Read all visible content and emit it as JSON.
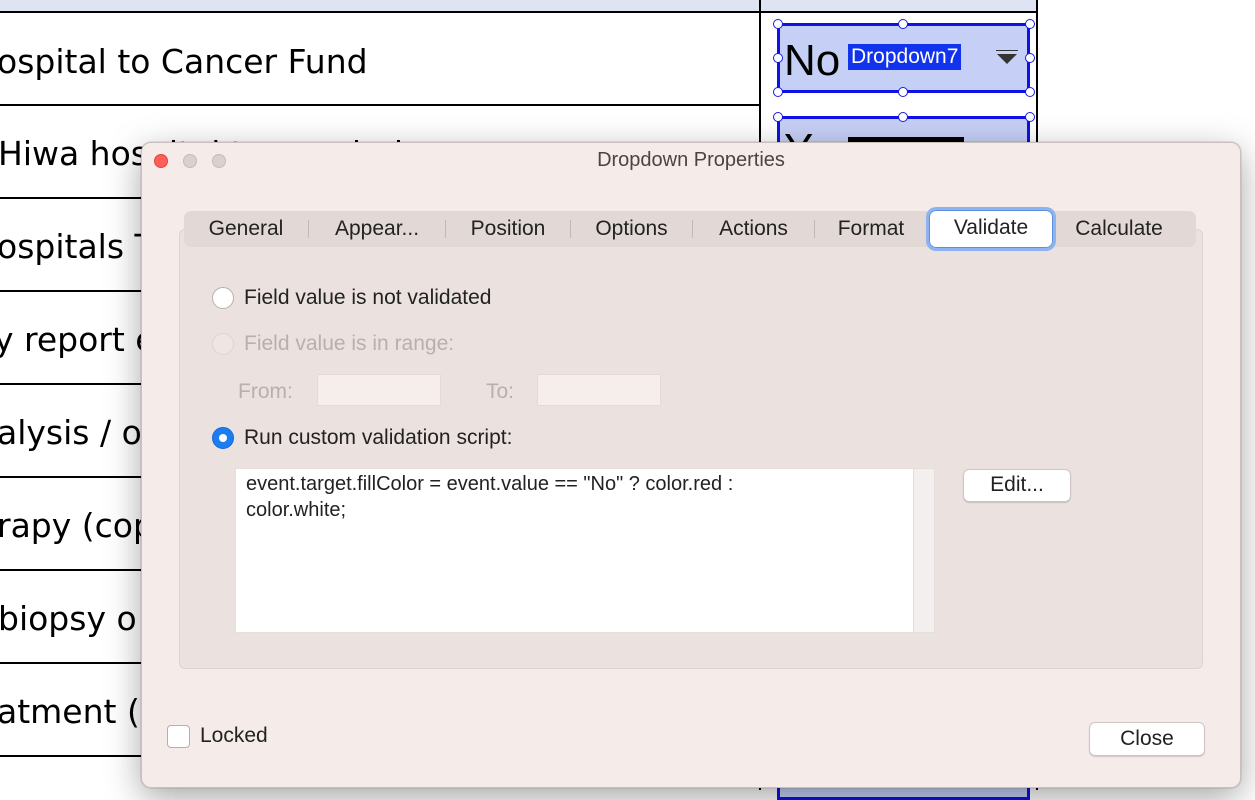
{
  "document": {
    "rows": [
      "ospital to Cancer Fund",
      " Hiwa hospital to conclude",
      "ospitals T",
      "y report e",
      "alysis / o",
      "rapy (cop",
      " biopsy o",
      "atment (i"
    ],
    "field1": {
      "value": "No",
      "name": "Dropdown7"
    },
    "field2": {
      "value": "Y"
    }
  },
  "dialog": {
    "title": "Dropdown Properties",
    "tabs": [
      "General",
      "Appear...",
      "Position",
      "Options",
      "Actions",
      "Format",
      "Validate",
      "Calculate"
    ],
    "selected_tab": "Validate",
    "validate": {
      "option_not_validated": "Field value is not validated",
      "option_in_range": "Field value is in range:",
      "from_label": "From:",
      "to_label": "To:",
      "from_value": "",
      "to_value": "",
      "option_custom_script": "Run custom validation script:",
      "selected_option": "custom_script",
      "script": "event.target.fillColor = event.value == \"No\" ? color.red :\ncolor.white;",
      "edit_label": "Edit..."
    },
    "locked_label": "Locked",
    "locked_checked": false,
    "close_label": "Close"
  },
  "colors": {
    "accent": "#1c7cf4",
    "field_fill": "#c6d0f6",
    "field_border": "#1010e8",
    "dialog_bg": "#f5ebe8",
    "window_close": "#ff5f57"
  },
  "icons": [
    "close-window-icon",
    "minimize-window-icon",
    "zoom-window-icon",
    "dropdown-arrow-icon",
    "selection-handle-icon"
  ]
}
